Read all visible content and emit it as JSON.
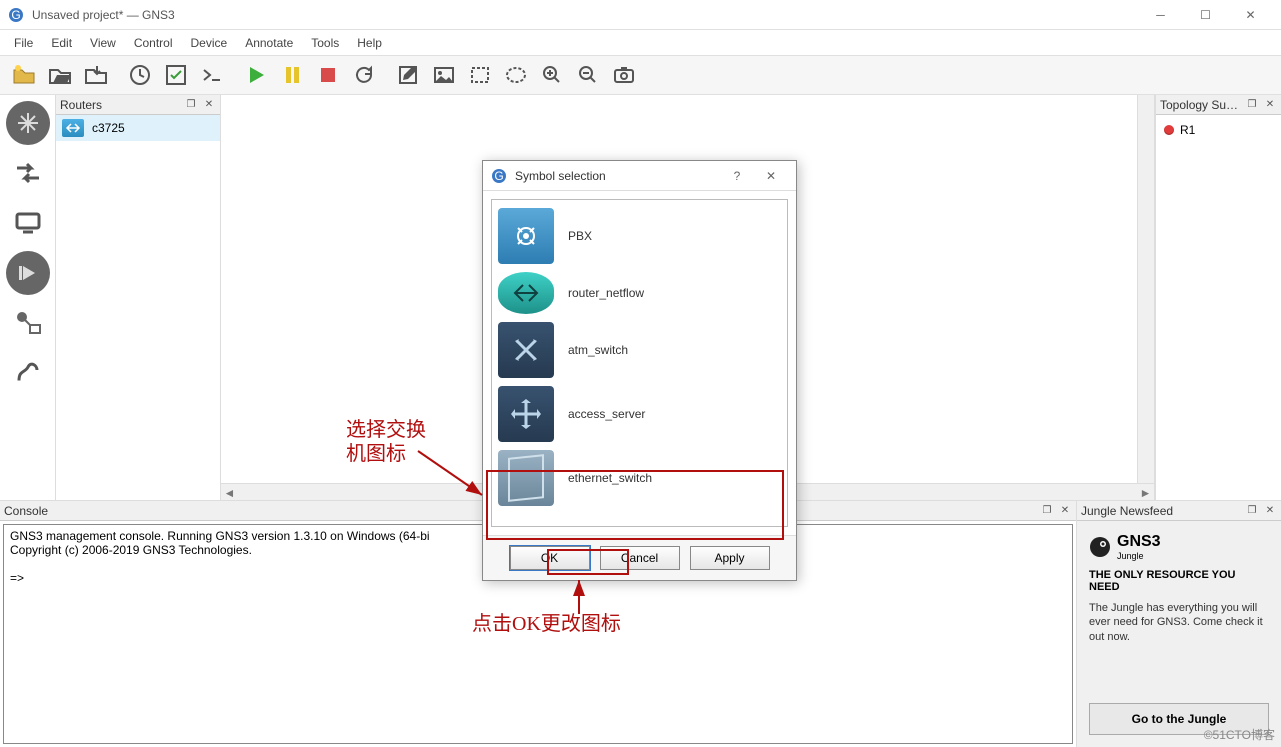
{
  "window": {
    "title": "Unsaved project* — GNS3"
  },
  "menu": {
    "items": [
      "File",
      "Edit",
      "View",
      "Control",
      "Device",
      "Annotate",
      "Tools",
      "Help"
    ]
  },
  "toolbar": {
    "icons": [
      "new-project-icon",
      "open-project-icon",
      "save-project-icon",
      "reload-icon",
      "net-check-icon",
      "console-icon",
      "play-icon",
      "pause-icon",
      "stop-icon",
      "refresh-icon",
      "note-icon",
      "image-icon",
      "rect-select-icon",
      "ellipse-select-icon",
      "zoom-in-icon",
      "zoom-out-icon",
      "screenshot-icon"
    ]
  },
  "dock": {
    "icons": [
      "move-all-icon",
      "arrow-left-icon",
      "monitor-icon",
      "skip-icon",
      "router-small-icon",
      "monitor-small-icon",
      "link-icon"
    ]
  },
  "panels": {
    "routers": {
      "title": "Routers",
      "items": [
        {
          "label": "c3725"
        }
      ]
    },
    "topology": {
      "title": "Topology Su…",
      "items": [
        {
          "label": "R1"
        }
      ]
    },
    "console": {
      "title": "Console",
      "line1": "GNS3 management console. Running GNS3 version 1.3.10 on Windows (64-bi",
      "line2": "Copyright (c) 2006-2019 GNS3 Technologies.",
      "prompt": "=>"
    },
    "newsfeed": {
      "title": "Jungle Newsfeed",
      "logo": "GNS3",
      "logo_sub": "Jungle",
      "headline": "THE ONLY RESOURCE YOU NEED",
      "body": "The Jungle has everything you will ever need for GNS3. Come check it out now.",
      "button": "Go to the Jungle"
    }
  },
  "dialog": {
    "title": "Symbol selection",
    "items": [
      {
        "label": "PBX",
        "style": "sym-blue"
      },
      {
        "label": "router_netflow",
        "style": "sym-teal"
      },
      {
        "label": "atm_switch",
        "style": "sym-dkblue"
      },
      {
        "label": "access_server",
        "style": "sym-dkblue"
      },
      {
        "label": "ethernet_switch",
        "style": "sym-grey"
      }
    ],
    "buttons": {
      "ok": "OK",
      "cancel": "Cancel",
      "apply": "Apply"
    }
  },
  "annotations": {
    "text1": "选择交换\n机图标",
    "text2": "点击OK更改图标"
  },
  "watermark": "©51CTO博客"
}
